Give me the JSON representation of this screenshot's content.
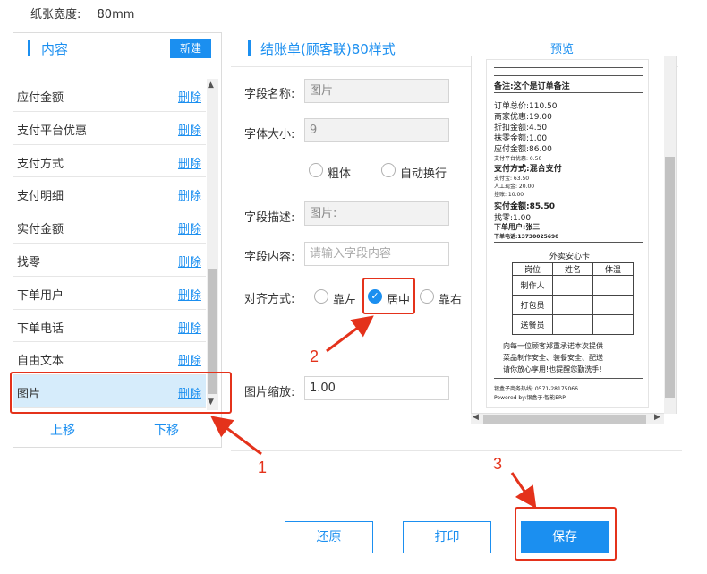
{
  "paper": {
    "label": "纸张宽度:",
    "value": "80mm"
  },
  "left_panel": {
    "title": "内容",
    "new_button": "新建",
    "items": [
      {
        "label": "应付金额",
        "action": "删除"
      },
      {
        "label": "支付平台优惠",
        "action": "删除"
      },
      {
        "label": "支付方式",
        "action": "删除"
      },
      {
        "label": "支付明细",
        "action": "删除"
      },
      {
        "label": "实付金额",
        "action": "删除"
      },
      {
        "label": "找零",
        "action": "删除"
      },
      {
        "label": "下单用户",
        "action": "删除"
      },
      {
        "label": "下单电话",
        "action": "删除"
      },
      {
        "label": "自由文本",
        "action": "删除"
      },
      {
        "label": "图片",
        "action": "删除"
      }
    ],
    "move_up": "上移",
    "move_down": "下移"
  },
  "form": {
    "title": "结账单(顾客联)80样式",
    "field_name_label": "字段名称:",
    "field_name_value": "图片",
    "font_size_label": "字体大小:",
    "font_size_value": "9",
    "bold_label": "粗体",
    "wrap_label": "自动换行",
    "desc_label": "字段描述:",
    "desc_value": "图片:",
    "content_label": "字段内容:",
    "content_placeholder": "请输入字段内容",
    "align_label": "对齐方式:",
    "align_left": "靠左",
    "align_center": "居中",
    "align_right": "靠右",
    "scale_label": "图片缩放:",
    "scale_value": "1.00"
  },
  "preview": {
    "tab": "预览",
    "receipt": {
      "note": "备注:这个是订单备注",
      "lines": [
        "订单总价:110.50",
        "商家优惠:19.00",
        "折扣金额:4.50",
        "抹零金额:1.00",
        "应付金额:86.00"
      ],
      "platform_discount": "支付平台优惠: 0.50",
      "pay_method": "支付方式:混合支付",
      "pay_details": [
        "支付宝: 63.50",
        "人工现金: 20.00",
        "挂账: 10.00"
      ],
      "paid": "实付金额:85.50",
      "change": "找零:1.00",
      "user": "下单用户:张三",
      "phone": "下单电话:13730025690",
      "card_title": "外卖安心卡",
      "card_headers": [
        "岗位",
        "姓名",
        "体温"
      ],
      "card_rows": [
        "制作人",
        "打包员",
        "送餐员"
      ],
      "card_notes": [
        "向每一位顾客郑重承诺本次提供",
        "菜品制作安全、装餐安全、配送",
        "请你放心享用!也提醒您勤洗手!"
      ],
      "hotline": "银盒子商务热线: 0571-28175066",
      "powered": "Powered by:银盒子·智能ERP"
    }
  },
  "buttons": {
    "restore": "还原",
    "print": "打印",
    "save": "保存"
  },
  "annotations": [
    "1",
    "2",
    "3"
  ],
  "colors": {
    "accent": "#1b8ff0",
    "annotation": "#e4321b",
    "selected_row": "#d6ecfb"
  }
}
